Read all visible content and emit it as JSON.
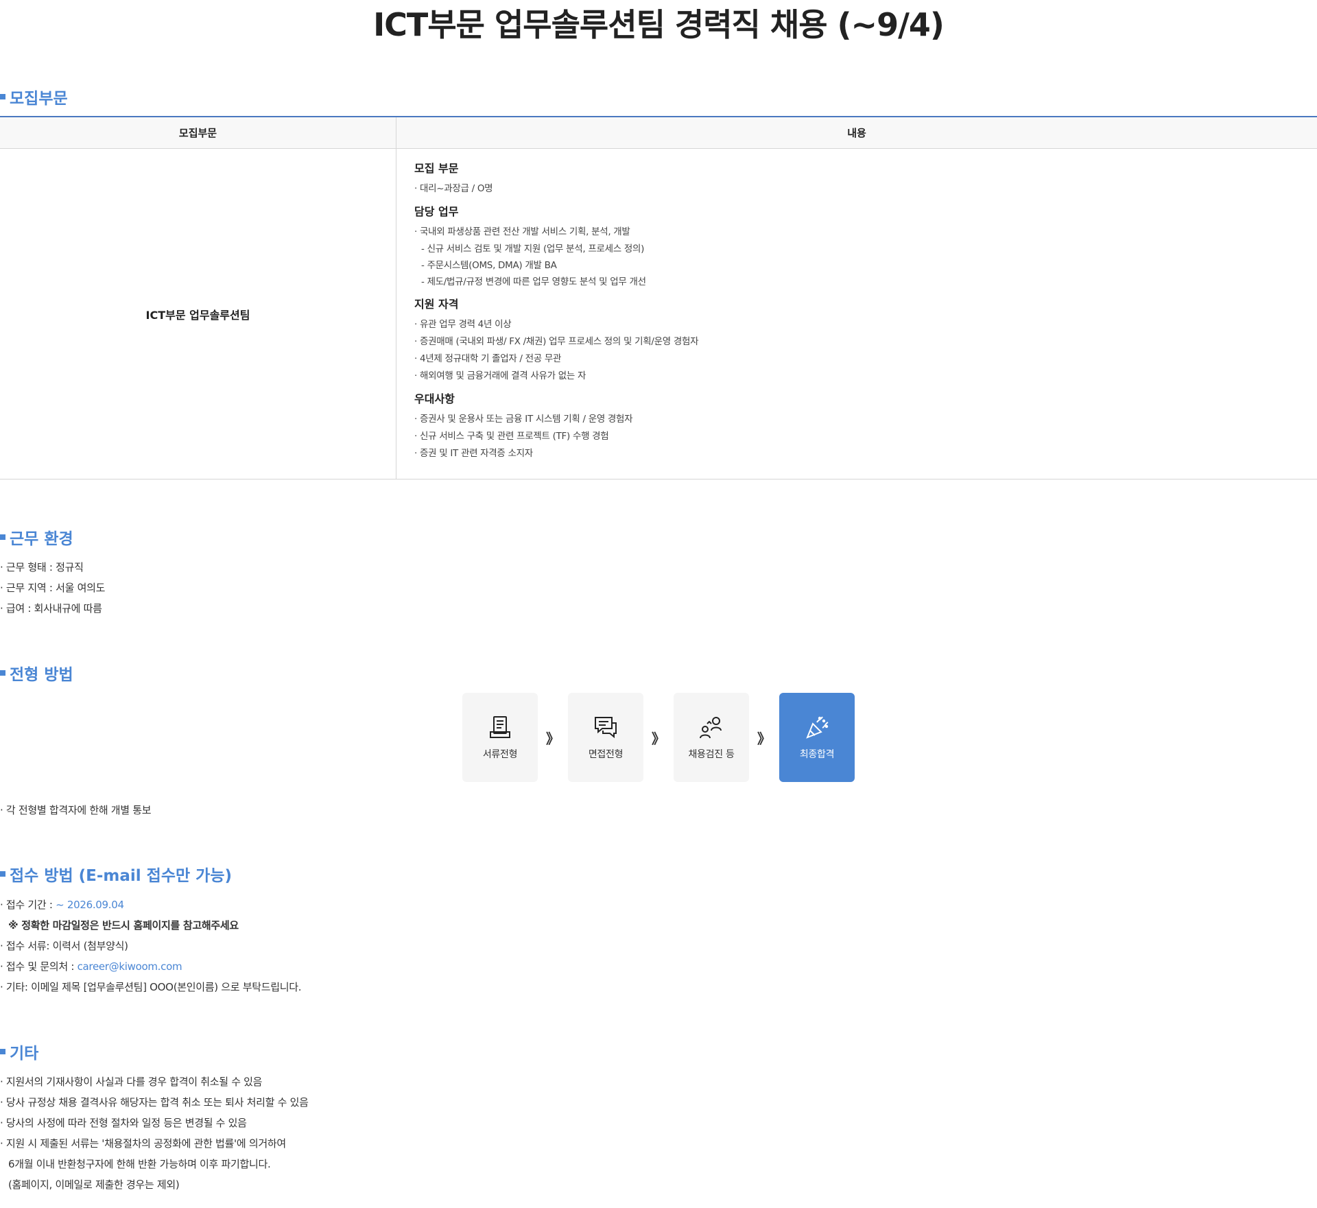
{
  "title": "ICT부문 업무솔루션팀 경력직 채용 (~9/4)",
  "sections": {
    "recruit": {
      "heading": "모집부문",
      "table": {
        "headers": [
          "모집부문",
          "내용"
        ],
        "team": "ICT부문 업무솔루션팀",
        "blocks": [
          {
            "title": "모집 부문",
            "lines": [
              {
                "text": "· 대리~과장급 / O명",
                "indent": false
              }
            ]
          },
          {
            "title": "담당 업무",
            "lines": [
              {
                "text": "· 국내외 파생상품 관련 전산 개발 서비스 기획, 분석, 개발",
                "indent": false
              },
              {
                "text": "- 신규 서비스 검토 및 개발 지원 (업무 분석, 프로세스 정의)",
                "indent": true
              },
              {
                "text": "- 주문시스템(OMS, DMA) 개발 BA",
                "indent": true
              },
              {
                "text": "- 제도/법규/규정 변경에 따른 업무 영향도 분석 및 업무 개선",
                "indent": true
              }
            ]
          },
          {
            "title": "지원 자격",
            "lines": [
              {
                "text": "· 유관 업무 경력 4년 이상",
                "indent": false
              },
              {
                "text": "· 증권매매 (국내외 파생/ FX /채권) 업무 프로세스 정의 및 기획/운영 경험자",
                "indent": false
              },
              {
                "text": "· 4년제 정규대학 기 졸업자 / 전공 무관",
                "indent": false
              },
              {
                "text": "· 해외여행 및 금융거래에 결격 사유가 없는 자",
                "indent": false
              }
            ]
          },
          {
            "title": "우대사항",
            "lines": [
              {
                "text": "· 증권사 및 운용사 또는 금융 IT 시스템 기획 / 운영 경험자",
                "indent": false
              },
              {
                "text": "· 신규 서비스 구축 및 관련 프로젝트 (TF) 수행 경험",
                "indent": false
              },
              {
                "text": "· 증권 및 IT 관련 자격증 소지자",
                "indent": false
              }
            ]
          }
        ]
      }
    },
    "environment": {
      "heading": "근무 환경",
      "lines": [
        "· 근무 형태 : 정규직",
        "· 근무 지역 : 서울 여의도",
        "· 급여 : 회사내규에 따름"
      ]
    },
    "process": {
      "heading": "전형 방법",
      "steps": [
        "서류전형",
        "면접전형",
        "채용검진 등",
        "최종합격"
      ],
      "arrow": "》",
      "note": "· 각 전형별 합격자에 한해 개별 통보"
    },
    "apply": {
      "heading": "접수 방법 (E-mail 접수만 가능)",
      "period_label": "· 접수 기간 : ",
      "period_value": "~ 2026.09.04",
      "notice": "※ 정확한 마감일정은 반드시 홈페이지를 참고해주세요",
      "docs": "· 접수 서류: 이력서 (첨부양식)",
      "contact_label": "· 접수 및 문의처 : ",
      "contact_email": "career@kiwoom.com",
      "etc": "· 기타: 이메일 제목 [업무솔루션팀] OOO(본인이름) 으로 부탁드립니다."
    },
    "other": {
      "heading": "기타",
      "lines": [
        "· 지원서의 기재사항이 사실과 다를 경우 합격이 취소될 수 있음",
        "· 당사 규정상 채용 결격사유 해당자는 합격 취소 또는 퇴사 처리할 수 있음",
        "· 당사의 사정에 따라 전형 절차와 일정 등은 변경될 수 있음",
        "· 지원 시 제출된 서류는 '채용절차의 공정화에 관한 법률'에 의거하여",
        "6개월 이내 반환청구자에 한해 반환 가능하며 이후 파기합니다.",
        "(홈페이지, 이메일로 제출한 경우는 제외)"
      ]
    }
  },
  "colors": {
    "accent": "#4a86d4",
    "final_step": "#4a86d4",
    "table_top_border": "#4a78c0"
  },
  "icons": [
    "document-icon",
    "chat-icon",
    "health-check-icon",
    "party-popper-icon"
  ]
}
